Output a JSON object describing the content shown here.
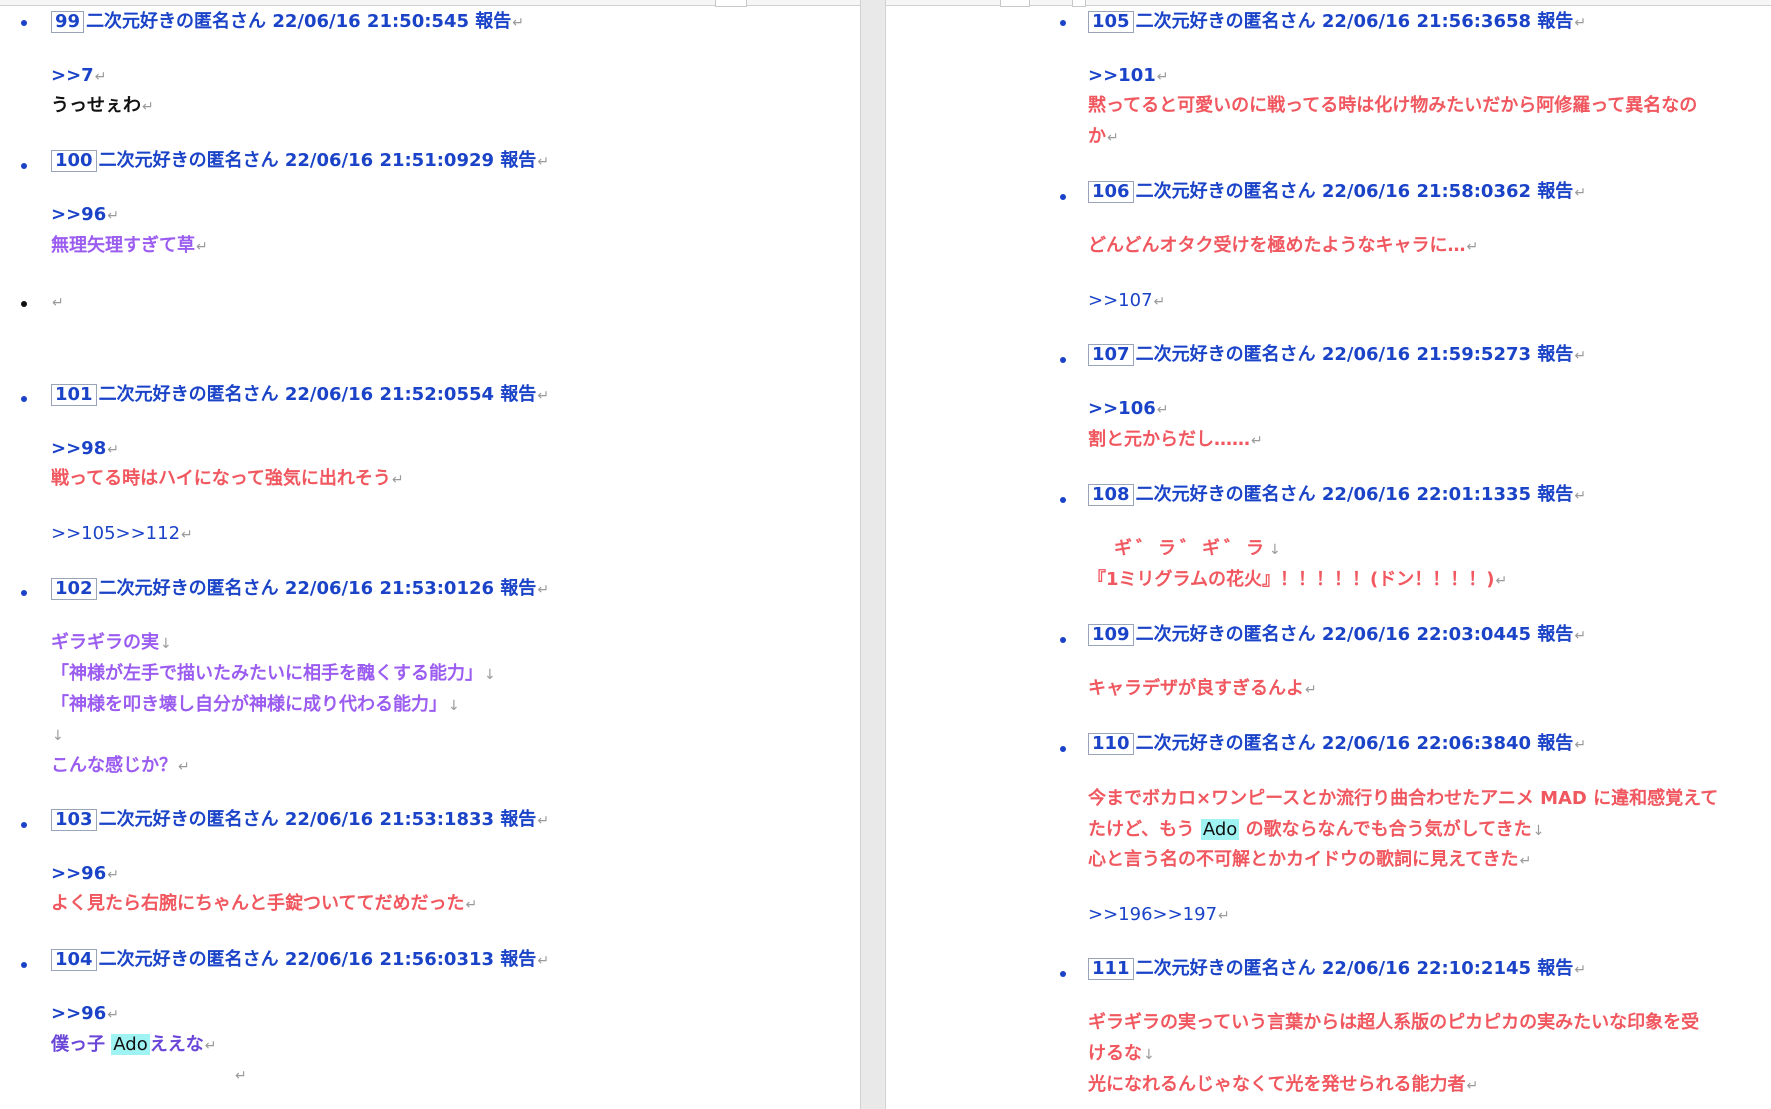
{
  "doc": {
    "para_mark": "↵",
    "line_break_mark": "↓",
    "bullet_char": "•",
    "report_label": "報告"
  },
  "left": [
    {
      "num": "99",
      "name": "二次元好きの匿名さん",
      "date": "22/06/16",
      "time": "21:50:545",
      "lines": [
        ">>7",
        "うっせぇわ"
      ]
    },
    {
      "num": "100",
      "name": "二次元好きの匿名さん",
      "date": "22/06/16",
      "time": "21:51:0929",
      "lines": [
        ">>96",
        "無理矢理すぎて草"
      ]
    },
    {
      "num": "101",
      "name": "二次元好きの匿名さん",
      "date": "22/06/16",
      "time": "21:52:0554",
      "lines": [
        ">>98",
        "戦ってる時はハイになって強気に出れそう",
        ">>105>>112"
      ]
    },
    {
      "num": "102",
      "name": "二次元好きの匿名さん",
      "date": "22/06/16",
      "time": "21:53:0126",
      "lines": [
        "ギラギラの実",
        "「神様が左手で描いたみたいに相手を醜くする能力」",
        "「神様を叩き壊し自分が神様に成り代わる能力」",
        "",
        "こんな感じか？"
      ]
    },
    {
      "num": "103",
      "name": "二次元好きの匿名さん",
      "date": "22/06/16",
      "time": "21:53:1833",
      "lines": [
        ">>96",
        "よく見たら右腕にちゃんと手錠ついててだめだった"
      ]
    },
    {
      "num": "104",
      "name": "二次元好きの匿名さん",
      "date": "22/06/16",
      "time": "21:56:0313",
      "lines": [
        ">>96",
        "僕っ子",
        "Ado",
        "ええな"
      ]
    }
  ],
  "right": [
    {
      "num": "105",
      "name": "二次元好きの匿名さん",
      "date": "22/06/16",
      "time": "21:56:3658",
      "lines": [
        ">>101",
        "黙ってると可愛いのに戦ってる時は化け物みたいだから阿修羅って異名なの",
        "か"
      ]
    },
    {
      "num": "106",
      "name": "二次元好きの匿名さん",
      "date": "22/06/16",
      "time": "21:58:0362",
      "lines": [
        "どんどんオタク受けを極めたようなキャラに…",
        ">>107"
      ]
    },
    {
      "num": "107",
      "name": "二次元好きの匿名さん",
      "date": "22/06/16",
      "time": "21:59:5273",
      "lines": [
        ">>106",
        "割と元からだし……"
      ]
    },
    {
      "num": "108",
      "name": "二次元好きの匿名さん",
      "date": "22/06/16",
      "time": "22:01:1335",
      "lines": [
        "ギ゛ラ゛ギ゛ラ",
        "『1ミリグラムの花火』！！！！！(ドン！！！！)"
      ]
    },
    {
      "num": "109",
      "name": "二次元好きの匿名さん",
      "date": "22/06/16",
      "time": "22:03:0445",
      "lines": [
        "キャラデザが良すぎるんよ"
      ]
    },
    {
      "num": "110",
      "name": "二次元好きの匿名さん",
      "date": "22/06/16",
      "time": "22:06:3840",
      "lines": [
        "今までボカロ×ワンピースとか流行り曲合わせたアニメ MAD に違和感覚えて",
        "たけど、もう",
        "Ado",
        "の歌ならなんでも合う気がしてきた",
        "心と言う名の不可解とかカイドウの歌詞に見えてきた",
        ">>196>>197"
      ]
    },
    {
      "num": "111",
      "name": "二次元好きの匿名さん",
      "date": "22/06/16",
      "time": "22:10:2145",
      "lines": [
        "ギラギラの実っていう言葉からは超人系版のピカピカの実みたいな印象を受",
        "けるな",
        "光になれるんじゃなくて光を発せられる能力者"
      ]
    }
  ]
}
